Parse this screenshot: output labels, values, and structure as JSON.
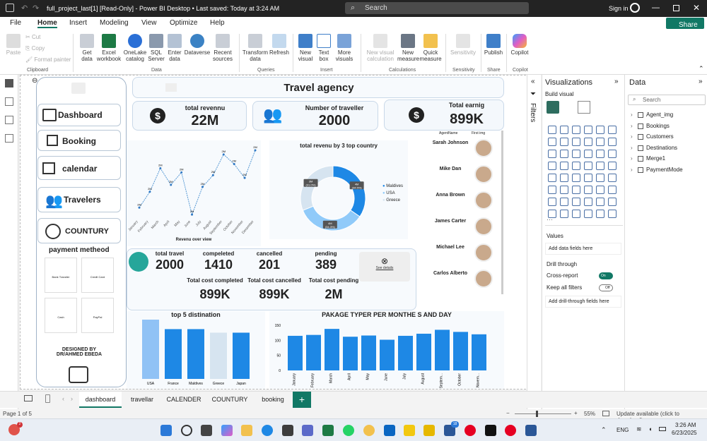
{
  "window": {
    "title": "full_project_last[1] [Read-Only] - Power BI Desktop • Last saved: Today at 3:24 AM",
    "search_placeholder": "Search",
    "signin": "Sign in"
  },
  "menu": [
    "File",
    "Home",
    "Insert",
    "Modeling",
    "View",
    "Optimize",
    "Help"
  ],
  "share": "Share",
  "ribbon": {
    "clipboard": {
      "paste": "Paste",
      "cut": "Cut",
      "copy": "Copy",
      "format_painter": "Format painter",
      "group": "Clipboard"
    },
    "data": {
      "items": [
        "Get data",
        "Excel workbook",
        "OneLake catalog",
        "SQL Server",
        "Enter data",
        "Dataverse",
        "Recent sources"
      ],
      "group": "Data"
    },
    "queries": {
      "items": [
        "Transform data",
        "Refresh"
      ],
      "group": "Queries"
    },
    "insert": {
      "items": [
        "New visual",
        "Text box",
        "More visuals"
      ],
      "group": "Insert"
    },
    "calculations": {
      "items": [
        "New visual calculation",
        "New measure",
        "Quick measure"
      ],
      "group": "Calculations"
    },
    "sensitivity": {
      "items": [
        "Sensitivity"
      ],
      "group": "Sensitivity"
    },
    "share": {
      "items": [
        "Publish"
      ],
      "group": "Share"
    },
    "copilot": {
      "items": [
        "Copilot"
      ],
      "group": "Copilot"
    }
  },
  "report": {
    "title": "Travel agency",
    "nav": [
      "Dashboard",
      "Booking",
      "calendar",
      "Travelers",
      "COUNTURY"
    ],
    "kpis": [
      {
        "label": "total revennu",
        "value": "22M"
      },
      {
        "label": "Number of traveller",
        "value": "2000"
      },
      {
        "label": "Total earnig",
        "value": "899K"
      }
    ],
    "payment": {
      "title": "payment metheod",
      "methods": [
        "Bank Transfer",
        "Credit Card",
        "Cash",
        "PayPal"
      ]
    },
    "designer": "DESIGNED BY\nDR/AHMED EBEDA",
    "line_chart": {
      "xlabel": "Revenu over view",
      "months": [
        "January",
        "February",
        "March",
        "April",
        "May",
        "June",
        "July",
        "August",
        "September",
        "October",
        "November",
        "December"
      ],
      "values": [
        2,
        2,
        2,
        2,
        2,
        2,
        2,
        2,
        2,
        2,
        2,
        2
      ],
      "point_label": "2M",
      "rel": [
        0.15,
        0.38,
        0.72,
        0.48,
        0.66,
        0.05,
        0.45,
        0.62,
        0.92,
        0.78,
        0.58,
        0.98
      ]
    },
    "donut": {
      "title": "total revenu by 3 top country",
      "legend": [
        "Maldives",
        "USA",
        "Greece"
      ],
      "colors": [
        "#1e88e5",
        "#90caf9",
        "#d6e4f0"
      ],
      "values": [
        34.5,
        34.3,
        31.0
      ],
      "labels": [
        "4M (34.5%)",
        "4M (34.3%)",
        "3M (31.0%)"
      ]
    },
    "agents": {
      "col1": "AgentName",
      "col2": "First img",
      "names": [
        "Sarah Johnson",
        "Mike Dan",
        "Anna Brown",
        "James Carter",
        "Michael Lee",
        "Carlos Alberto"
      ]
    },
    "stats": [
      {
        "label": "total travel",
        "value": "2000"
      },
      {
        "label": "compeleted",
        "value": "1410"
      },
      {
        "label": "cancelled",
        "value": "201"
      },
      {
        "label": "pending",
        "value": "389"
      }
    ],
    "costs": [
      {
        "label": "Total cost completed",
        "value": "899K"
      },
      {
        "label": "Total cost cancelled",
        "value": "899K"
      },
      {
        "label": "Total cost pending",
        "value": "2M"
      }
    ],
    "see_details": "See details",
    "top5": {
      "title": "top 5 distination",
      "categories": [
        "USA",
        "France",
        "Maldives",
        "Greece",
        "Japan"
      ],
      "rel": [
        1.0,
        0.84,
        0.84,
        0.78,
        0.78
      ]
    },
    "package": {
      "title": "PAKAGE TYPER PER MONTHE S AND DAY",
      "ticks": [
        "150",
        "100",
        "50",
        "0"
      ],
      "months": [
        "January",
        "February",
        "March",
        "April",
        "May",
        "June",
        "July",
        "August",
        "Septem...",
        "October",
        "Novem..."
      ],
      "values": [
        115,
        118,
        138,
        112,
        116,
        102,
        115,
        122,
        135,
        128,
        120
      ]
    }
  },
  "filters": "Filters",
  "viz": {
    "title": "Visualizations",
    "build": "Build visual",
    "values": "Values",
    "values_hint": "Add data fields here",
    "drill": "Drill through",
    "cross": "Cross-report",
    "cross_state": "On",
    "keep": "Keep all filters",
    "keep_state": "Off",
    "drill_hint": "Add drill-through fields here"
  },
  "data_pane": {
    "title": "Data",
    "search": "Search",
    "tables": [
      "Agent_img",
      "Bookings",
      "Customers",
      "Destinations",
      "Merge1",
      "PaymentMode"
    ]
  },
  "tabs": [
    "dashboard",
    "travellar",
    "CALENDER",
    "COUNTURY",
    "booking"
  ],
  "status": {
    "page": "Page 1 of 5",
    "zoom": "55%",
    "update": "Update available (click to download)"
  },
  "taskbar": {
    "time": "3:26 AM",
    "date": "6/23/2025",
    "lang": "ENG",
    "badge": "18"
  }
}
